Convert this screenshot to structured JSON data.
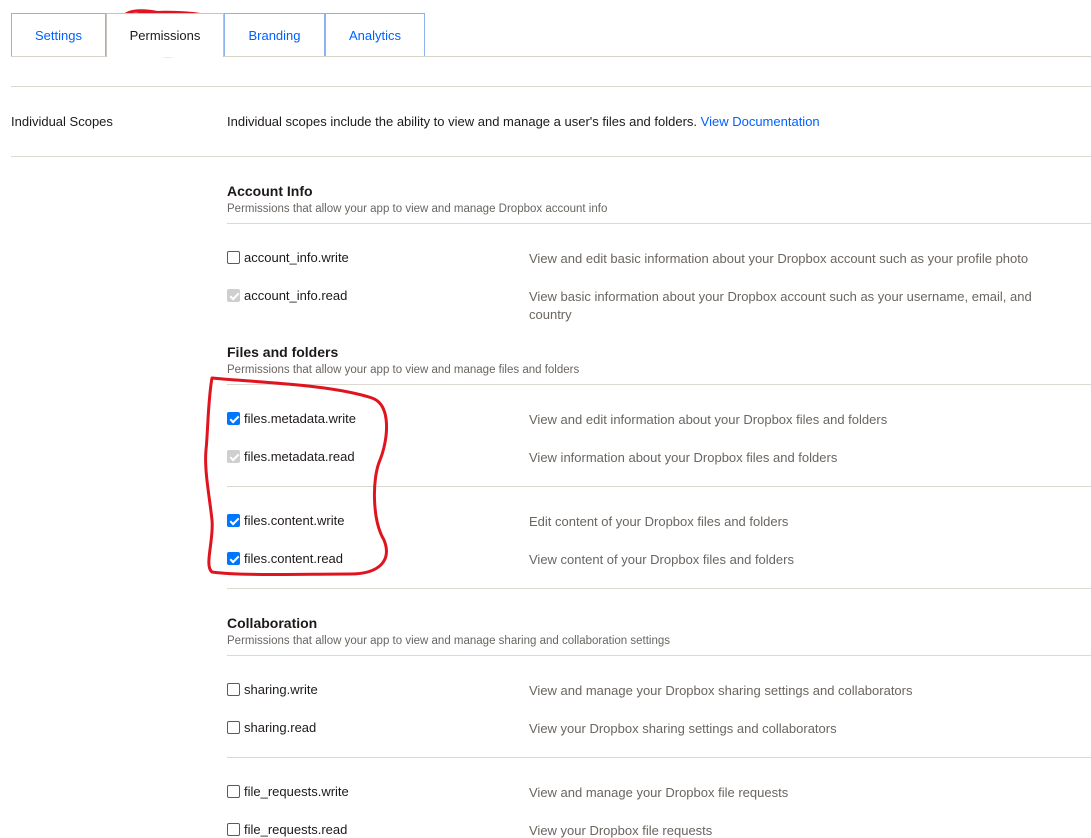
{
  "tabs": [
    {
      "label": "Settings"
    },
    {
      "label": "Permissions"
    },
    {
      "label": "Branding"
    },
    {
      "label": "Analytics"
    }
  ],
  "individual_scopes": {
    "label": "Individual Scopes",
    "description": "Individual scopes include the ability to view and manage a user's files and folders.",
    "doc_link": "View Documentation"
  },
  "sections": {
    "account_info": {
      "title": "Account Info",
      "subtitle": "Permissions that allow your app to view and manage Dropbox account info"
    },
    "files_and_folders": {
      "title": "Files and folders",
      "subtitle": "Permissions that allow your app to view and manage files and folders"
    },
    "collaboration": {
      "title": "Collaboration",
      "subtitle": "Permissions that allow your app to view and manage sharing and collaboration settings"
    }
  },
  "permissions": {
    "account_info_write": {
      "name": "account_info.write",
      "desc": "View and edit basic information about your Dropbox account such as your profile photo",
      "state": "unchecked"
    },
    "account_info_read": {
      "name": "account_info.read",
      "desc": "View basic information about your Dropbox account such as your username, email, and country",
      "state": "checked-disabled"
    },
    "files_metadata_write": {
      "name": "files.metadata.write",
      "desc": "View and edit information about your Dropbox files and folders",
      "state": "checked"
    },
    "files_metadata_read": {
      "name": "files.metadata.read",
      "desc": "View information about your Dropbox files and folders",
      "state": "checked-disabled"
    },
    "files_content_write": {
      "name": "files.content.write",
      "desc": "Edit content of your Dropbox files and folders",
      "state": "checked"
    },
    "files_content_read": {
      "name": "files.content.read",
      "desc": "View content of your Dropbox files and folders",
      "state": "checked"
    },
    "sharing_write": {
      "name": "sharing.write",
      "desc": "View and manage your Dropbox sharing settings and collaborators",
      "state": "unchecked"
    },
    "sharing_read": {
      "name": "sharing.read",
      "desc": "View your Dropbox sharing settings and collaborators",
      "state": "unchecked"
    },
    "file_requests_write": {
      "name": "file_requests.write",
      "desc": "View and manage your Dropbox file requests",
      "state": "unchecked"
    },
    "file_requests_read": {
      "name": "file_requests.read",
      "desc": "View your Dropbox file requests",
      "state": "unchecked"
    }
  },
  "colors": {
    "link": "#0061fe",
    "checkbox_checked": "#0075ff",
    "annotation": "#e0141e"
  }
}
